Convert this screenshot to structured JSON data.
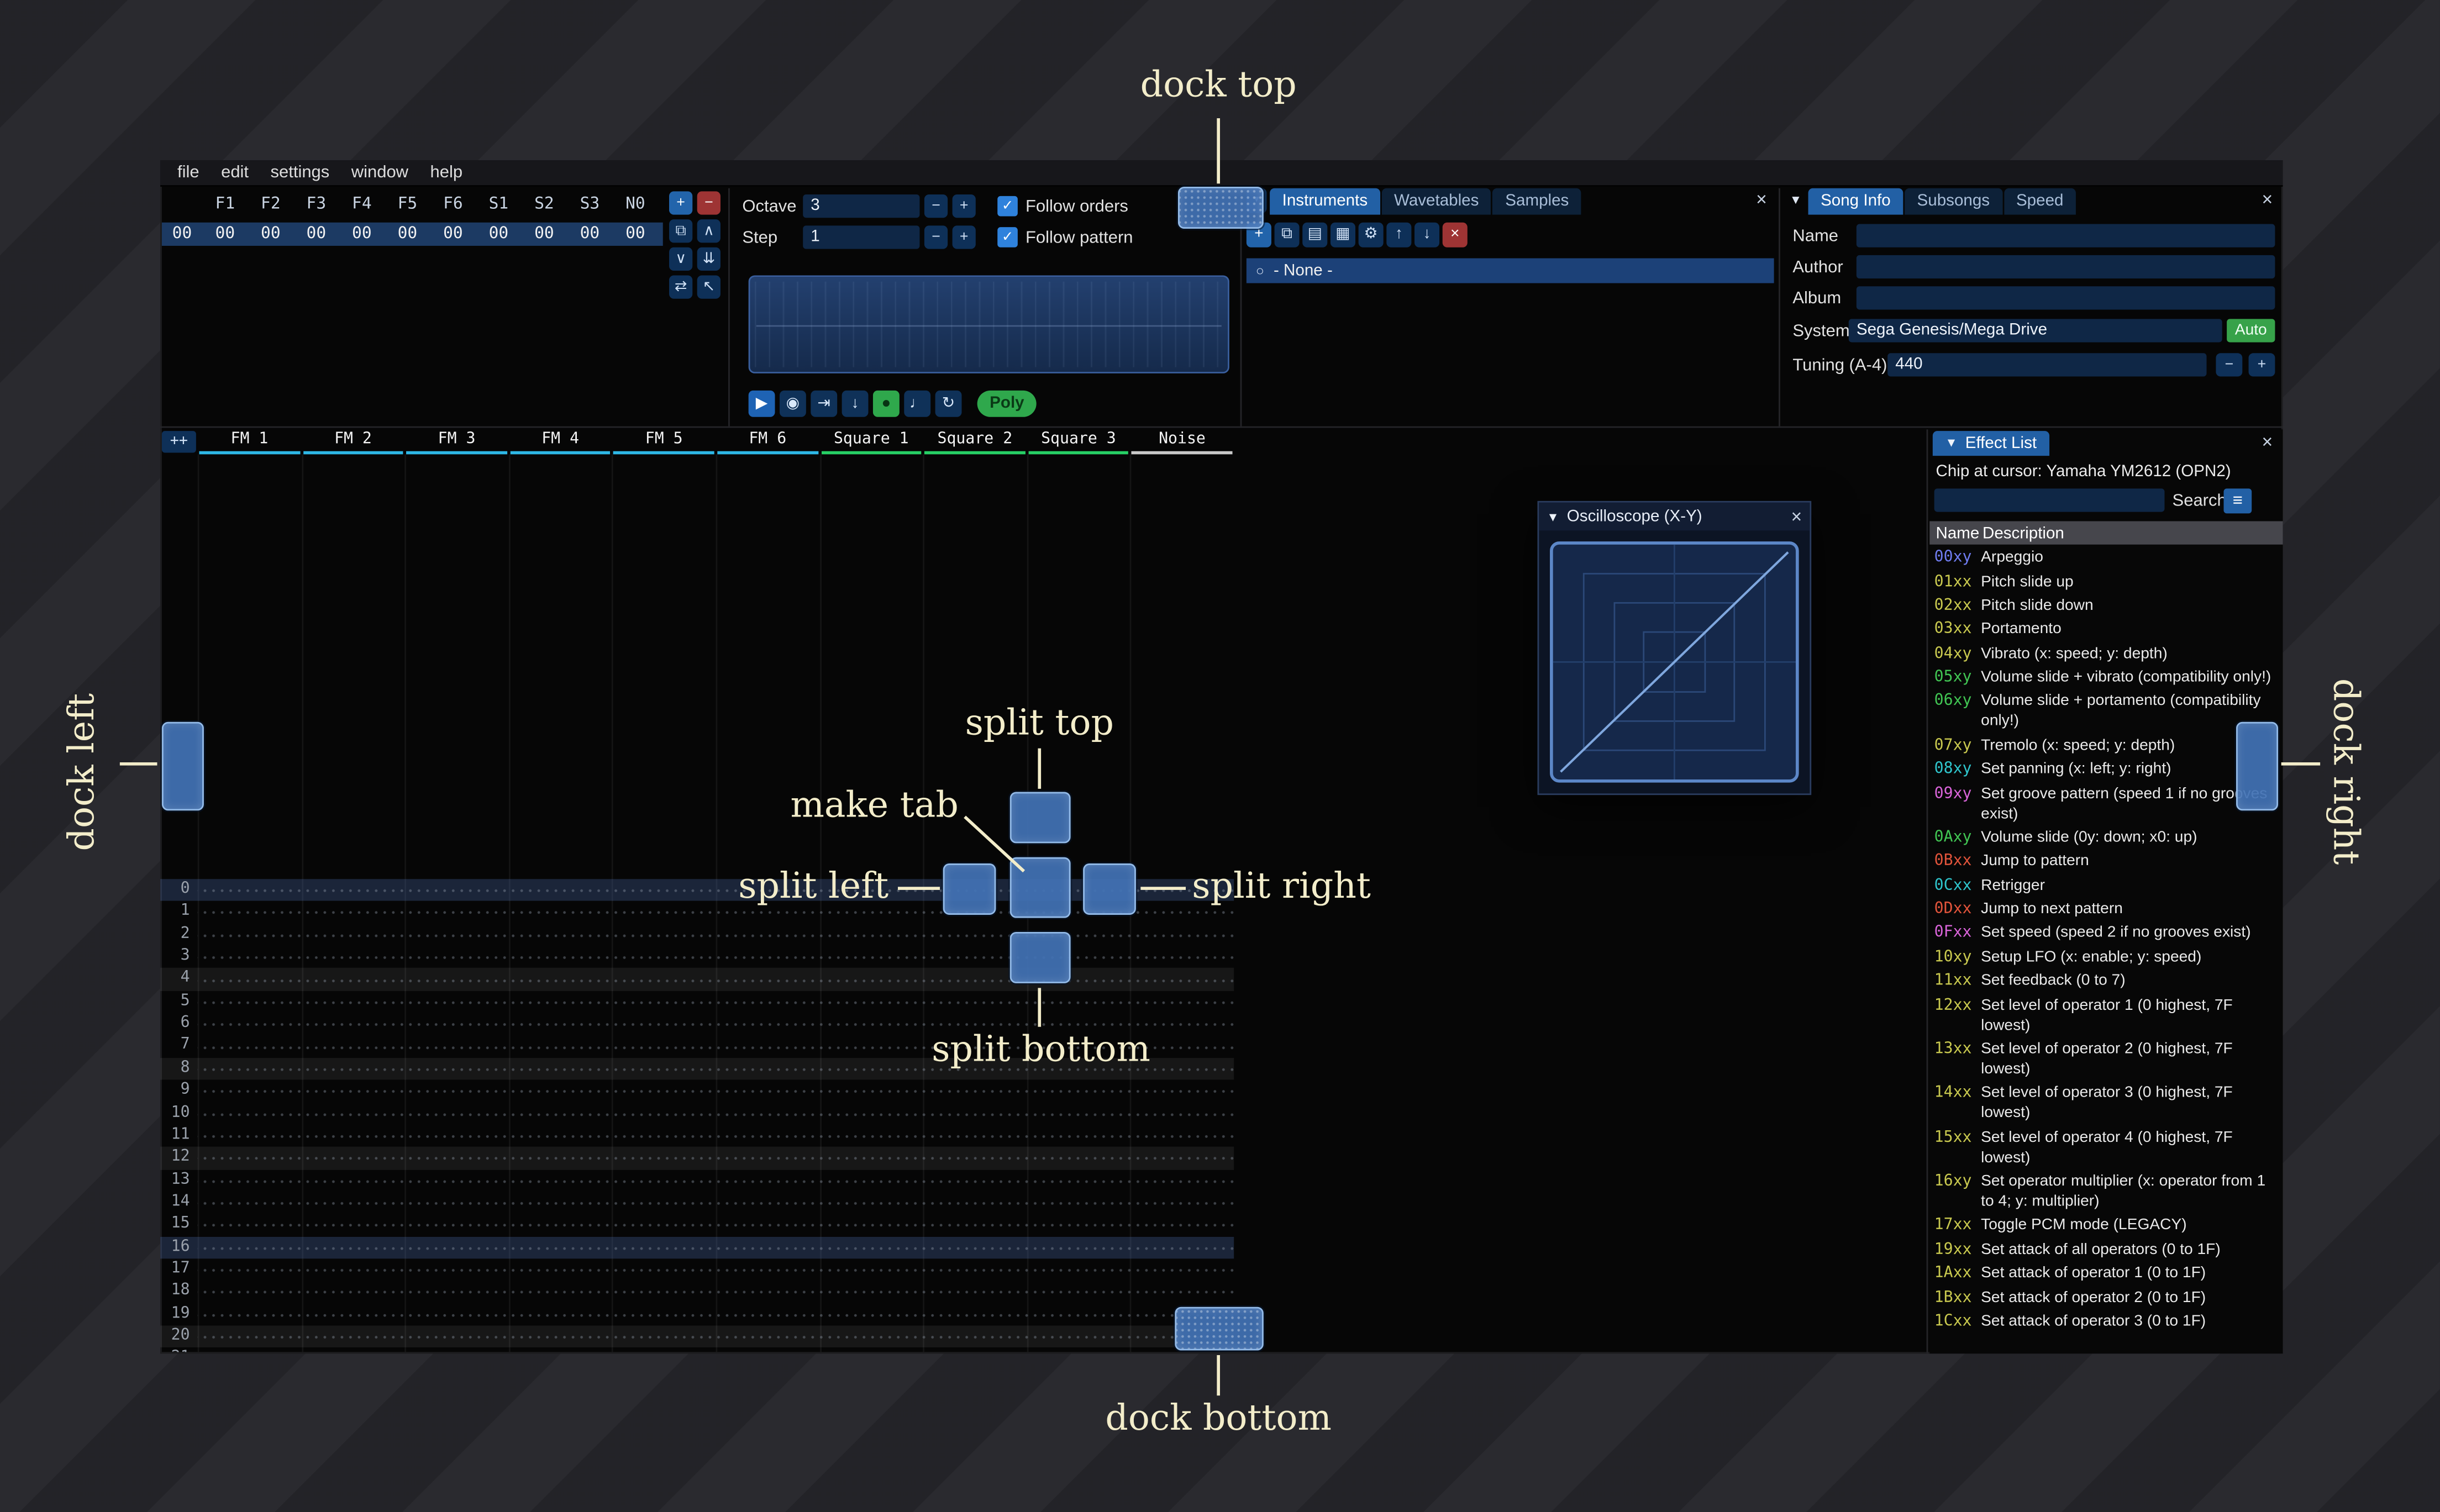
{
  "icons": {
    "plus": "+",
    "minus": "−",
    "copy": "⧉",
    "chevron_up": "∧",
    "chevron_down": "∨",
    "double_down": "⇊",
    "swap": "⇄",
    "cursor": "↖",
    "play": "▶",
    "play_circle": "◉",
    "step_forward": "⇥",
    "arrow_down": "↓",
    "record": "●",
    "metronome": "♩",
    "repeat": "↻",
    "folder": "▤",
    "save": "▦",
    "gear": "⚙",
    "arrow_up": "↑",
    "close": "×",
    "collapse": "▼",
    "dropdown": "▾",
    "radio": "○",
    "check": "✓",
    "hamburger": "≡"
  },
  "annotations": {
    "dock_top": "dock top",
    "dock_bottom": "dock bottom",
    "dock_left": "dock left",
    "dock_right": "dock right",
    "split_top": "split top",
    "split_bottom": "split bottom",
    "split_left": "split left",
    "split_right": "split right",
    "make_tab": "make tab"
  },
  "menu": {
    "items": [
      "file",
      "edit",
      "settings",
      "window",
      "help"
    ]
  },
  "orders": {
    "index_value": "00",
    "columns": [
      "F1",
      "F2",
      "F3",
      "F4",
      "F5",
      "F6",
      "S1",
      "S2",
      "S3",
      "N0"
    ],
    "row_values": [
      "00",
      "00",
      "00",
      "00",
      "00",
      "00",
      "00",
      "00",
      "00",
      "00"
    ],
    "buttons": [
      {
        "name": "add-order",
        "icon": "plus",
        "style": "accent"
      },
      {
        "name": "remove-order",
        "icon": "minus",
        "style": "danger"
      },
      {
        "name": "duplicate-order",
        "icon": "copy"
      },
      {
        "name": "move-order-up",
        "icon": "chevron_up"
      },
      {
        "name": "move-order-down",
        "icon": "chevron_down"
      },
      {
        "name": "duplicate-order-deep",
        "icon": "double_down"
      },
      {
        "name": "order-change-mode",
        "icon": "swap"
      },
      {
        "name": "order-edit-cursor",
        "icon": "cursor"
      }
    ]
  },
  "controls": {
    "octave_label": "Octave",
    "octave_value": "3",
    "step_label": "Step",
    "step_value": "1",
    "follow_orders": "Follow orders",
    "follow_pattern": "Follow pattern",
    "poly_label": "Poly",
    "transport": [
      {
        "name": "play-button",
        "icon": "play",
        "style": "accent"
      },
      {
        "name": "play-pattern-button",
        "icon": "play_circle"
      },
      {
        "name": "play-from-cursor-button",
        "icon": "step_forward"
      },
      {
        "name": "stop-button",
        "icon": "arrow_down"
      },
      {
        "name": "edit-record-button",
        "icon": "record",
        "style": "rec"
      },
      {
        "name": "metronome-button",
        "icon": "metronome"
      },
      {
        "name": "repeat-pattern-button",
        "icon": "repeat"
      }
    ]
  },
  "instruments_panel": {
    "tabs": [
      {
        "label": "Instruments",
        "selected": true
      },
      {
        "label": "Wavetables",
        "selected": false
      },
      {
        "label": "Samples",
        "selected": false
      }
    ],
    "toolbar": [
      {
        "name": "add-instrument-button",
        "icon": "plus",
        "style": "accent"
      },
      {
        "name": "duplicate-instrument-button",
        "icon": "copy"
      },
      {
        "name": "open-instrument-button",
        "icon": "folder"
      },
      {
        "name": "save-instrument-button",
        "icon": "save"
      },
      {
        "name": "instrument-options-button",
        "icon": "gear"
      },
      {
        "name": "move-instrument-up-button",
        "icon": "arrow_up"
      },
      {
        "name": "move-instrument-down-button",
        "icon": "arrow_down"
      },
      {
        "name": "delete-instrument-button",
        "icon": "close",
        "style": "danger"
      }
    ],
    "list_item": "- None -"
  },
  "song_info": {
    "tabs": [
      {
        "label": "Song Info",
        "selected": true
      },
      {
        "label": "Subsongs",
        "selected": false
      },
      {
        "label": "Speed",
        "selected": false
      }
    ],
    "name_label": "Name",
    "name_value": "",
    "author_label": "Author",
    "author_value": "",
    "album_label": "Album",
    "album_value": "",
    "system_label": "System",
    "system_value": "Sega Genesis/Mega Drive",
    "auto_label": "Auto",
    "tuning_label": "Tuning (A-4)",
    "tuning_value": "440"
  },
  "pattern": {
    "corner_label": "++",
    "row_count": 22,
    "channels": [
      {
        "name": "FM 1",
        "color": "#2eb8e6"
      },
      {
        "name": "FM 2",
        "color": "#2eb8e6"
      },
      {
        "name": "FM 3",
        "color": "#2eb8e6"
      },
      {
        "name": "FM 4",
        "color": "#2eb8e6"
      },
      {
        "name": "FM 5",
        "color": "#2eb8e6"
      },
      {
        "name": "FM 6",
        "color": "#2eb8e6"
      },
      {
        "name": "Square 1",
        "color": "#27d065"
      },
      {
        "name": "Square 2",
        "color": "#27d065"
      },
      {
        "name": "Square 3",
        "color": "#27d065"
      },
      {
        "name": "Noise",
        "color": "#c9c9c9"
      }
    ]
  },
  "oscilloscope": {
    "title": "Oscilloscope (X-Y)"
  },
  "effect_list": {
    "title": "Effect List",
    "chip_label": "Chip at cursor: Yamaha YM2612 (OPN2)",
    "search_label": "Search",
    "search_value": "",
    "name_header": "Name",
    "description_header": "Description",
    "effects": [
      {
        "code": "00xy",
        "color": "#6f7cf0",
        "desc": "Arpeggio"
      },
      {
        "code": "01xx",
        "color": "#c9c94f",
        "desc": "Pitch slide up"
      },
      {
        "code": "02xx",
        "color": "#c9c94f",
        "desc": "Pitch slide down"
      },
      {
        "code": "03xx",
        "color": "#c9c94f",
        "desc": "Portamento"
      },
      {
        "code": "04xy",
        "color": "#c9c94f",
        "desc": "Vibrato (x: speed; y: depth)"
      },
      {
        "code": "05xy",
        "color": "#41c553",
        "desc": "Volume slide + vibrato (compatibility only!)"
      },
      {
        "code": "06xy",
        "color": "#41c553",
        "desc": "Volume slide + portamento (compatibility only!)"
      },
      {
        "code": "07xy",
        "color": "#c9c94f",
        "desc": "Tremolo (x: speed; y: depth)"
      },
      {
        "code": "08xy",
        "color": "#2fc5cc",
        "desc": "Set panning (x: left; y: right)"
      },
      {
        "code": "09xy",
        "color": "#d964d9",
        "desc": "Set groove pattern (speed 1 if no grooves exist)"
      },
      {
        "code": "0Axy",
        "color": "#41c553",
        "desc": "Volume slide (0y: down; x0: up)"
      },
      {
        "code": "0Bxx",
        "color": "#e2543b",
        "desc": "Jump to pattern"
      },
      {
        "code": "0Cxx",
        "color": "#2fc5cc",
        "desc": "Retrigger"
      },
      {
        "code": "0Dxx",
        "color": "#e2543b",
        "desc": "Jump to next pattern"
      },
      {
        "code": "0Fxx",
        "color": "#d964d9",
        "desc": "Set speed (speed 2 if no grooves exist)"
      },
      {
        "code": "10xy",
        "color": "#c9c94f",
        "desc": "Setup LFO (x: enable; y: speed)"
      },
      {
        "code": "11xx",
        "color": "#c9c94f",
        "desc": "Set feedback (0 to 7)"
      },
      {
        "code": "12xx",
        "color": "#c9c94f",
        "desc": "Set level of operator 1 (0 highest, 7F lowest)"
      },
      {
        "code": "13xx",
        "color": "#c9c94f",
        "desc": "Set level of operator 2 (0 highest, 7F lowest)"
      },
      {
        "code": "14xx",
        "color": "#c9c94f",
        "desc": "Set level of operator 3 (0 highest, 7F lowest)"
      },
      {
        "code": "15xx",
        "color": "#c9c94f",
        "desc": "Set level of operator 4 (0 highest, 7F lowest)"
      },
      {
        "code": "16xy",
        "color": "#c9c94f",
        "desc": "Set operator multiplier (x: operator from 1 to 4; y: multiplier)"
      },
      {
        "code": "17xx",
        "color": "#c9c94f",
        "desc": "Toggle PCM mode (LEGACY)"
      },
      {
        "code": "19xx",
        "color": "#c9c94f",
        "desc": "Set attack of all operators (0 to 1F)"
      },
      {
        "code": "1Axx",
        "color": "#c9c94f",
        "desc": "Set attack of operator 1 (0 to 1F)"
      },
      {
        "code": "1Bxx",
        "color": "#c9c94f",
        "desc": "Set attack of operator 2 (0 to 1F)"
      },
      {
        "code": "1Cxx",
        "color": "#c9c94f",
        "desc": "Set attack of operator 3 (0 to 1F)"
      }
    ]
  }
}
